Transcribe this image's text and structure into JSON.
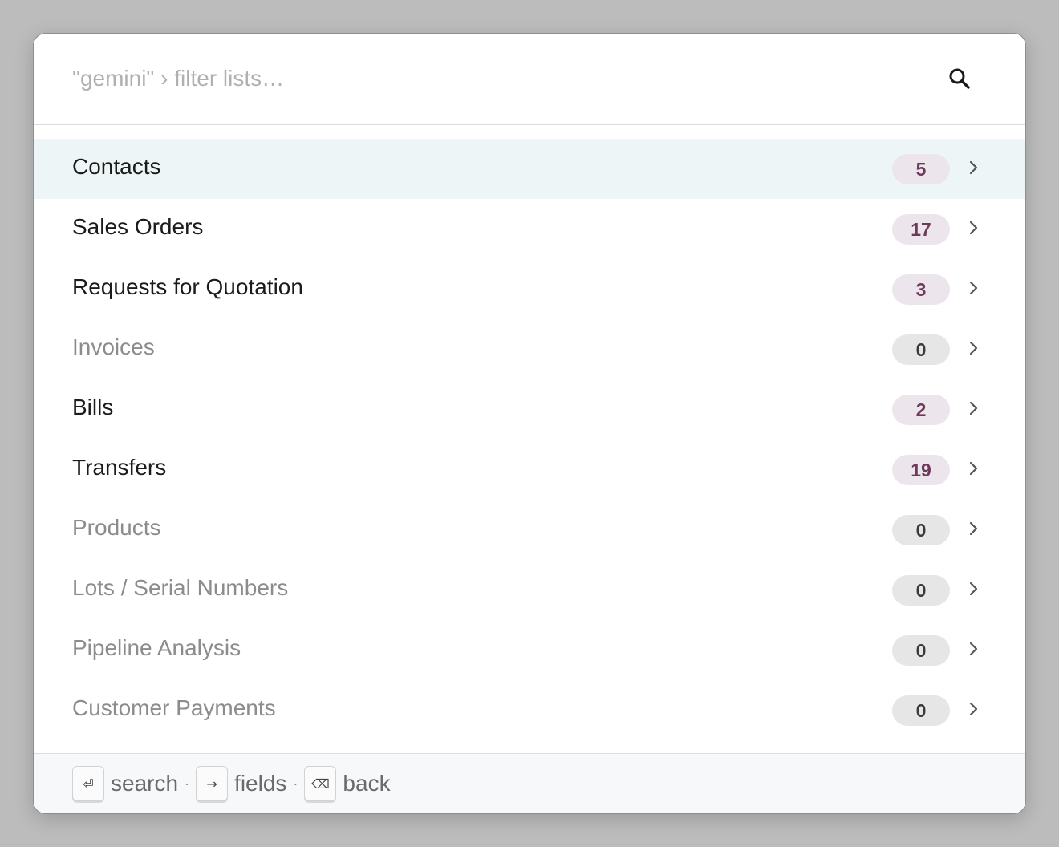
{
  "search": {
    "placeholder": "\"gemini\" › filter lists…",
    "value": "",
    "icon": "search-icon"
  },
  "lists": [
    {
      "label": "Contacts",
      "count": "5",
      "active": true,
      "empty": false
    },
    {
      "label": "Sales Orders",
      "count": "17",
      "active": false,
      "empty": false
    },
    {
      "label": "Requests for Quotation",
      "count": "3",
      "active": false,
      "empty": false
    },
    {
      "label": "Invoices",
      "count": "0",
      "active": false,
      "empty": true
    },
    {
      "label": "Bills",
      "count": "2",
      "active": false,
      "empty": false
    },
    {
      "label": "Transfers",
      "count": "19",
      "active": false,
      "empty": false
    },
    {
      "label": "Products",
      "count": "0",
      "active": false,
      "empty": true
    },
    {
      "label": "Lots / Serial Numbers",
      "count": "0",
      "active": false,
      "empty": true
    },
    {
      "label": "Pipeline Analysis",
      "count": "0",
      "active": false,
      "empty": true
    },
    {
      "label": "Customer Payments",
      "count": "0",
      "active": false,
      "empty": true
    }
  ],
  "footer": {
    "hints": [
      {
        "key": "⏎",
        "label": "search"
      },
      {
        "key": "→",
        "label": "fields"
      },
      {
        "key": "⌫",
        "label": "back"
      }
    ],
    "separator": "·"
  },
  "colors": {
    "active_row": "#edf5f6",
    "badge_bg": "#ece6ec",
    "badge_text": "#6e3a5c",
    "empty_badge_bg": "#e6e6e6"
  }
}
